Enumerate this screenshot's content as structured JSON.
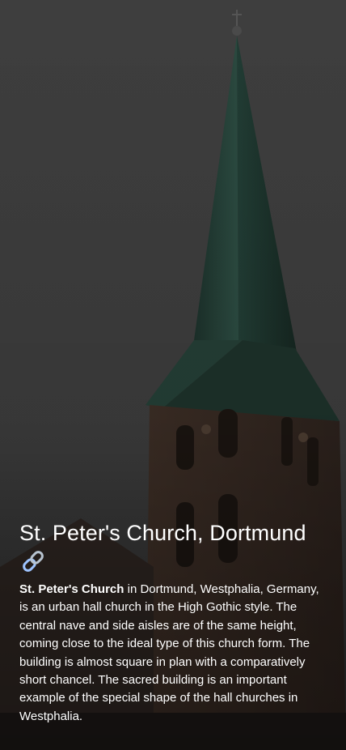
{
  "place": {
    "title": "St. Peter's Church, Dortmund",
    "link_icon": "link-icon",
    "name_bold": "St. Peter's Church",
    "description_rest": " in Dortmund, Westphalia, Germany, is an urban hall church in the High Gothic style. The central nave and side aisles are of the same height, coming close to the ideal type of this church form. The building is almost square in plan with a comparatively short chancel. The sacred building is an important example of the special shape of the hall churches in Westphalia."
  },
  "colors": {
    "sky": "#3c3c3c",
    "spire": "#1f3b33",
    "brick": "#3a2b22",
    "text": "#ffffff",
    "link": "#7fb3ff"
  }
}
